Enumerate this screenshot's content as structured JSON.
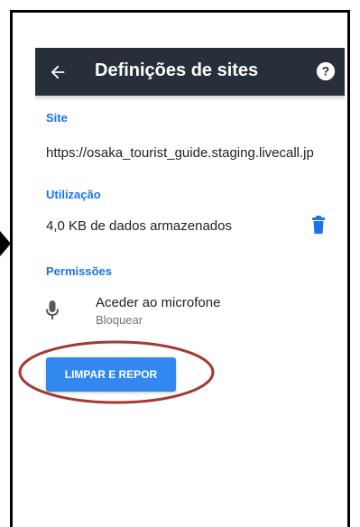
{
  "colors": {
    "toolbar": "#27303a",
    "accent": "#1a73e8",
    "button": "#3388f0",
    "highlight": "#a33a32"
  },
  "toolbar": {
    "title": "Definições de sites",
    "back_icon": "arrow-back-icon",
    "help_icon": "help-icon"
  },
  "site": {
    "label": "Site",
    "url": "https://osaka_tourist_guide.staging.livecall.jp"
  },
  "usage": {
    "label": "Utilização",
    "text": "4,0 KB de dados armazenados",
    "delete_icon": "delete-icon"
  },
  "permissions": {
    "label": "Permissões",
    "items": [
      {
        "icon": "microphone-icon",
        "title": "Aceder ao microfone",
        "status": "Bloquear"
      }
    ]
  },
  "actions": {
    "reset_label": "LIMPAR E REPOR"
  }
}
